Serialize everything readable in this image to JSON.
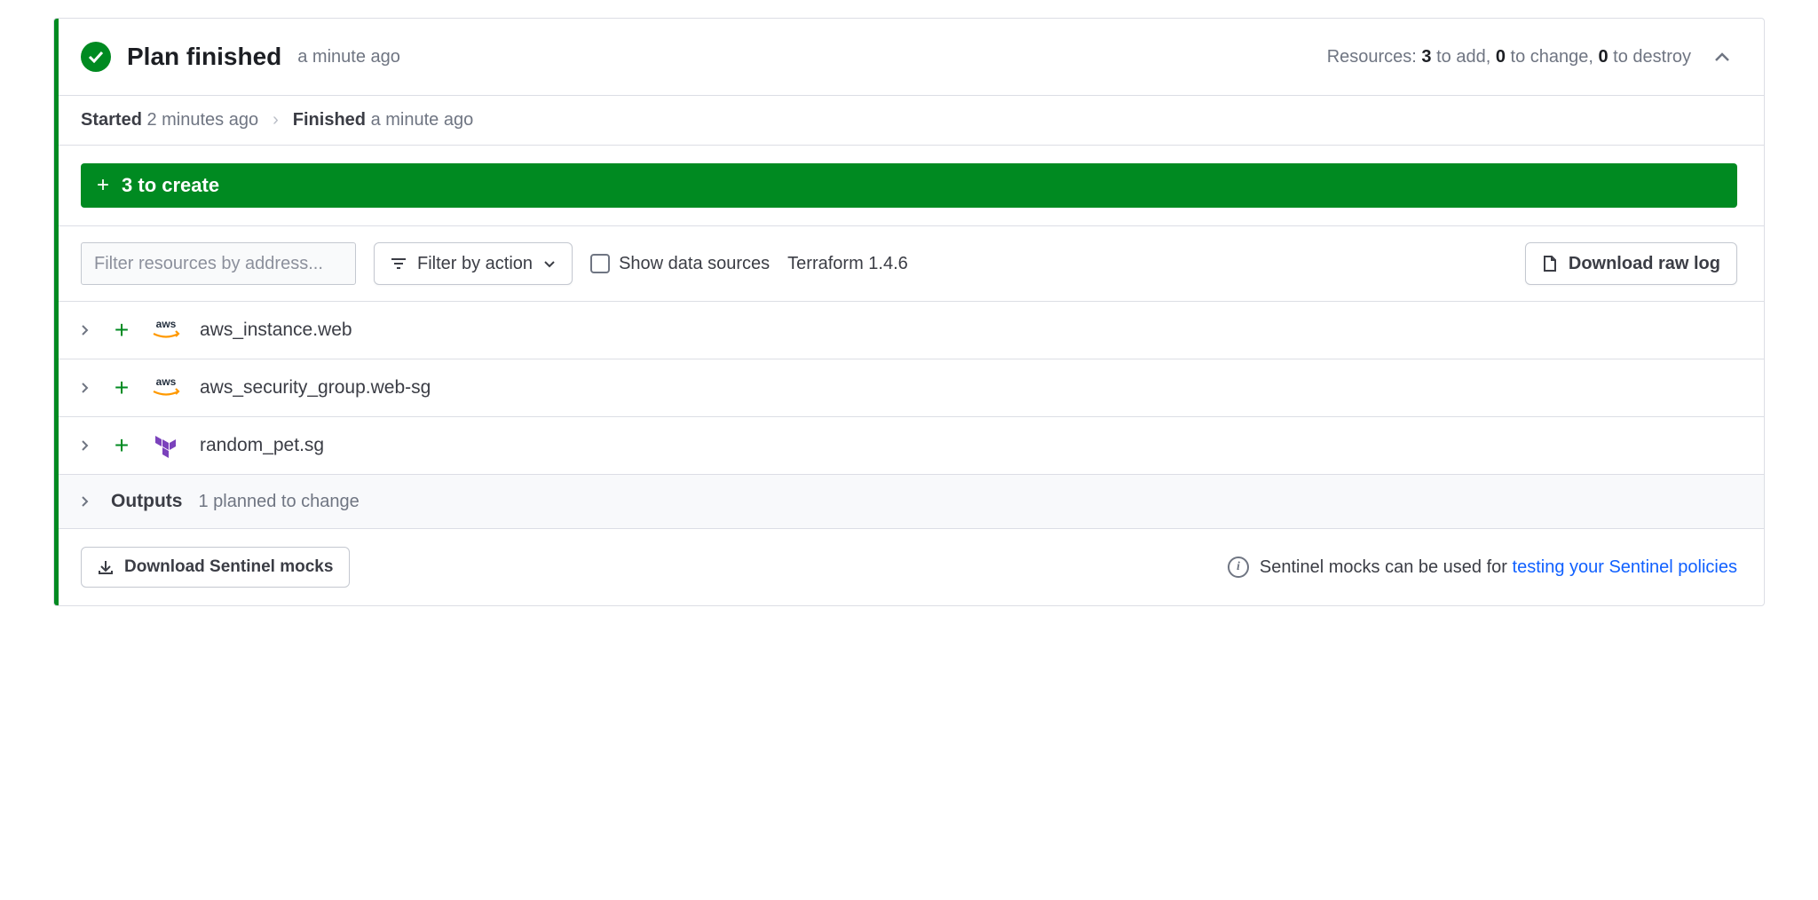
{
  "header": {
    "title": "Plan finished",
    "subtitle": "a minute ago",
    "summary_prefix": "Resources: ",
    "to_add": "3",
    "to_add_suffix": " to add, ",
    "to_change": "0",
    "to_change_suffix": " to change, ",
    "to_destroy": "0",
    "to_destroy_suffix": " to destroy"
  },
  "timeline": {
    "started_label": "Started",
    "started_time": "2 minutes ago",
    "finished_label": "Finished",
    "finished_time": "a minute ago"
  },
  "create_bar": {
    "label": "3 to create"
  },
  "filters": {
    "placeholder": "Filter resources by address...",
    "action_label": "Filter by action",
    "show_ds_label": "Show data sources",
    "tf_version": "Terraform 1.4.6",
    "download_raw": "Download raw log"
  },
  "resources": [
    {
      "provider": "aws",
      "name": "aws_instance.web"
    },
    {
      "provider": "aws",
      "name": "aws_security_group.web-sg"
    },
    {
      "provider": "terraform",
      "name": "random_pet.sg"
    }
  ],
  "outputs": {
    "label": "Outputs",
    "sub": "1 planned to change"
  },
  "footer": {
    "download_mocks": "Download Sentinel mocks",
    "info_text": "Sentinel mocks can be used for ",
    "info_link": "testing your Sentinel policies"
  }
}
